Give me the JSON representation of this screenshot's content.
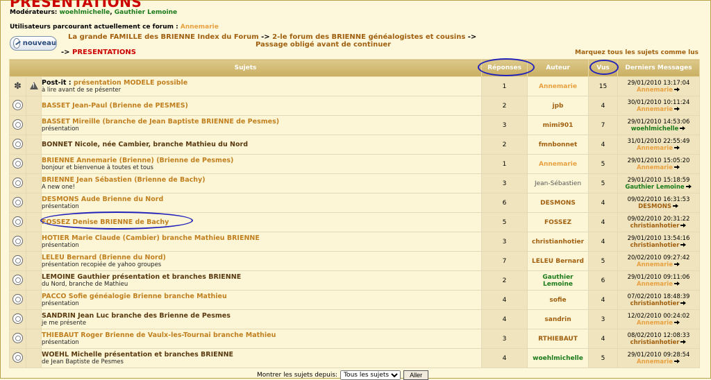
{
  "page": {
    "title": "PRÉSENTATIONS",
    "moderators_label": "Modérateurs:",
    "moderators": [
      {
        "name": "woehlmichelle"
      },
      {
        "name": "Gauthier Lemoine"
      }
    ],
    "users_label": "Utilisateurs parcourant actuellement ce forum :",
    "users": "Annemarie",
    "new_topic_label": "nouveau",
    "breadcrumb": {
      "part1": "La grande FAMILLE des BRIENNE Index du Forum",
      "sep": "->",
      "part2": "2-le forum des BRIENNE généalogistes et cousins",
      "part3": "Passage obligé avant de continuer",
      "current": "PRESENTATIONS"
    },
    "mark_all": "Marquez tous les sujets comme lus"
  },
  "table": {
    "headers": {
      "subjects": "Sujets",
      "replies": "Réponses",
      "author": "Auteur",
      "views": "Vus",
      "last": "Derniers Messages"
    },
    "rows": [
      {
        "prefix": "Post-it :",
        "title": "présentation MODELE possible",
        "desc": "à lire avant de se pésenter",
        "replies": "1",
        "author": "Annemarie",
        "views": "15",
        "date": "29/01/2010 13:17:04",
        "last_by": "Annemarie"
      },
      {
        "prefix": "",
        "title": "BASSET Jean-Paul (Brienne de PESMES)",
        "desc": "",
        "replies": "2",
        "author": "jpb",
        "views": "4",
        "date": "30/01/2010 10:11:24",
        "last_by": "Annemarie"
      },
      {
        "prefix": "",
        "title": "BASSET Mireille (branche de Jean Baptiste BRIENNE de Pesmes)",
        "desc": "présentation",
        "replies": "3",
        "author": "mimi901",
        "views": "7",
        "date": "29/01/2010 14:53:06",
        "last_by": "woehlmichelle"
      },
      {
        "prefix": "",
        "title": "BONNET Nicole, née Cambier, branche Mathieu du Nord",
        "desc": "",
        "replies": "2",
        "author": "fmnbonnet",
        "views": "4",
        "date": "31/01/2010 22:55:49",
        "last_by": "Annemarie"
      },
      {
        "prefix": "",
        "title": "BRIENNE Annemarie (Brienne) (Brienne de Pesmes)",
        "desc": "bonjour et bienvenue à toutes et tous",
        "replies": "1",
        "author": "Annemarie",
        "views": "5",
        "date": "29/01/2010 15:05:20",
        "last_by": "Annemarie"
      },
      {
        "prefix": "",
        "title": "BRIENNE Jean Sébastien (Brienne de Bachy)",
        "desc": "A new one!",
        "replies": "3",
        "author": "Jean-Sébastien",
        "views": "5",
        "date": "29/01/2010 15:18:59",
        "last_by": "Gauthier Lemoine"
      },
      {
        "prefix": "",
        "title": "DESMONS Aude Brienne du Nord",
        "desc": "présentation",
        "replies": "6",
        "author": "DESMONS",
        "views": "4",
        "date": "09/02/2010 16:31:53",
        "last_by": "DESMONS"
      },
      {
        "prefix": "",
        "title": "FOSSEZ Denise BRIENNE de Bachy",
        "desc": "",
        "replies": "5",
        "author": "FOSSEZ",
        "views": "4",
        "date": "09/02/2010 20:31:22",
        "last_by": "christianhotier"
      },
      {
        "prefix": "",
        "title": "HOTIER Marie Claude (Cambier) branche Mathieu BRIENNE",
        "desc": "présentation",
        "replies": "3",
        "author": "christianhotier",
        "views": "4",
        "date": "29/01/2010 13:54:16",
        "last_by": "christianhotier"
      },
      {
        "prefix": "",
        "title": "LELEU Bernard (Brienne du Nord)",
        "desc": "présentation recopiée de yahoo groupes",
        "replies": "7",
        "author": "LELEU Bernard",
        "views": "5",
        "date": "20/02/2010 09:27:42",
        "last_by": "Annemarie"
      },
      {
        "prefix": "",
        "title": "LEMOINE Gauthier présentation et branches BRIENNE",
        "desc": "du Nord, branche de Mathieu",
        "replies": "2",
        "author": "Gauthier Lemoine",
        "views": "6",
        "date": "29/01/2010 09:11:06",
        "last_by": "Annemarie"
      },
      {
        "prefix": "",
        "title": "PACCO Sofie généalogie Brienne branche Mathieu",
        "desc": "présentation",
        "replies": "4",
        "author": "sofie",
        "views": "4",
        "date": "07/02/2010 18:48:39",
        "last_by": "christianhotier"
      },
      {
        "prefix": "",
        "title": "SANDRIN Jean Luc branche des Brienne de Pesmes",
        "desc": "je me présente",
        "replies": "4",
        "author": "sandrin",
        "views": "3",
        "date": "12/02/2010 00:24:02",
        "last_by": "Annemarie"
      },
      {
        "prefix": "",
        "title": "THIEBAUT Roger Brienne de Vaulx-les-Tournai branche Mathieu",
        "desc": "présentation",
        "replies": "3",
        "author": "RTHIEBAUT",
        "views": "4",
        "date": "08/02/2010 12:08:33",
        "last_by": "christianhotier"
      },
      {
        "prefix": "",
        "title": "WOEHL Michelle présentation et branches BRIENNE",
        "desc": "de Jean Baptiste de Pesmes",
        "replies": "4",
        "author": "woehlmichelle",
        "views": "5",
        "date": "29/01/2010 09:28:54",
        "last_by": "Annemarie"
      }
    ]
  },
  "footer": {
    "label": "Montrer les sujets depuis:",
    "select_value": "Tous les sujets",
    "go_label": "Aller"
  },
  "icons": [
    "topic-icon",
    "announcement-icon",
    "warning-icon",
    "goto-last-icon",
    "new-topic-icon"
  ],
  "colors": {
    "accent": "#c08020",
    "title_red": "#cc0000",
    "green": "#1a7a1a",
    "annotation": "#2222bb"
  }
}
